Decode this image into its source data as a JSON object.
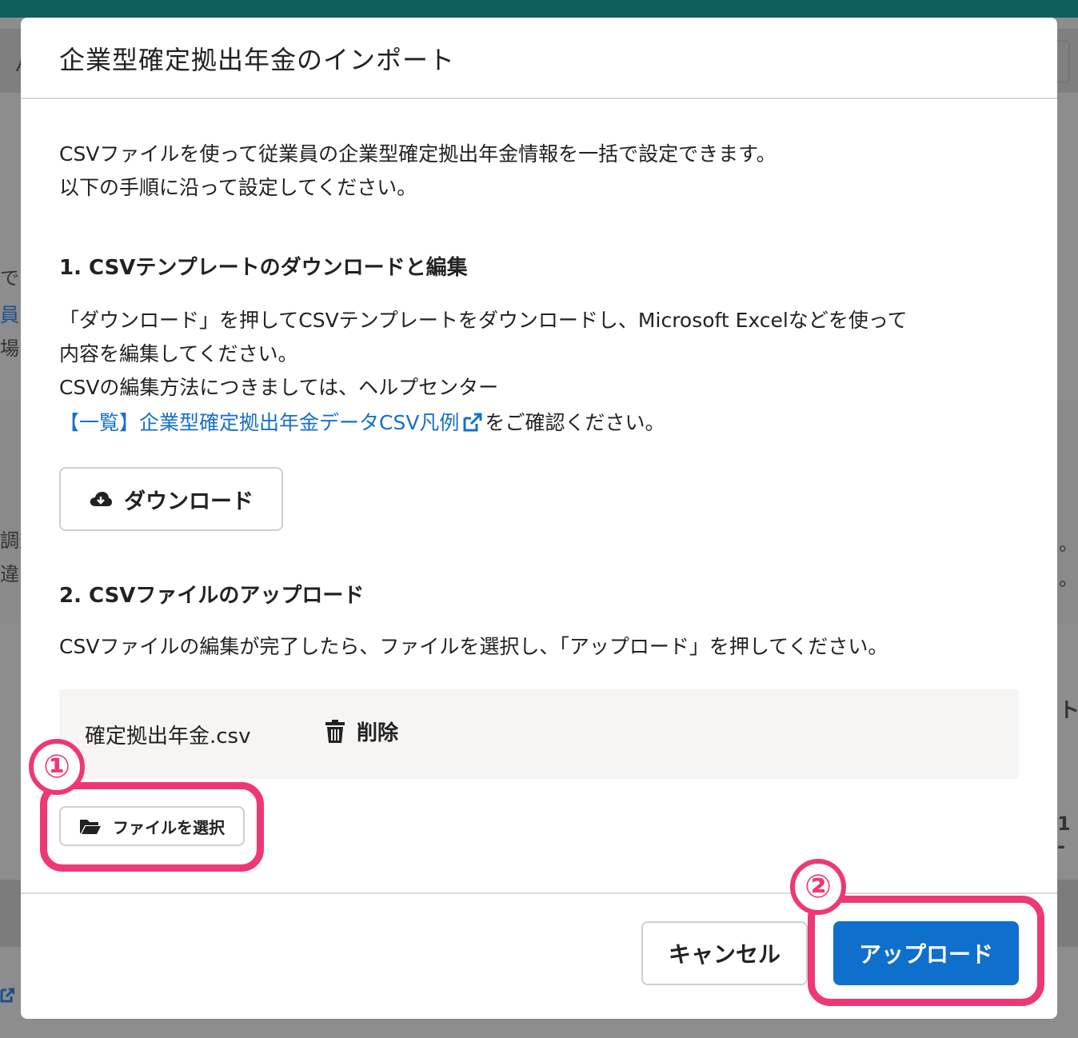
{
  "background": {
    "fragments": [
      "パ",
      "で",
      "員",
      "場",
      "調査",
      "違",
      "。",
      "。",
      "ト",
      "1 -"
    ]
  },
  "modal": {
    "title": "企業型確定拠出年金のインポート",
    "intro_line1": "CSVファイルを使って従業員の企業型確定拠出年金情報を一括で設定できます。",
    "intro_line2": "以下の手順に沿って設定してください。",
    "step1": {
      "heading": "1. CSVテンプレートのダウンロードと編集",
      "text_line1": "「ダウンロード」を押してCSVテンプレートをダウンロードし、Microsoft Excelなどを使って",
      "text_line2": "内容を編集してください。",
      "text_line3": "CSVの編集方法につきましては、ヘルプセンター",
      "help_link": "【一覧】企業型確定拠出年金データCSV凡例",
      "text_after_link": "をご確認ください。",
      "download_label": "ダウンロード"
    },
    "step2": {
      "heading": "2. CSVファイルのアップロード",
      "text": "CSVファイルの編集が完了したら、ファイルを選択し、「アップロード」を押してください。",
      "file_name": "確定拠出年金.csv",
      "delete_label": "削除",
      "select_label": "ファイルを選択"
    },
    "footer": {
      "cancel_label": "キャンセル",
      "upload_label": "アップロード"
    }
  },
  "annotations": {
    "callout1": "①",
    "callout2": "②",
    "color": "#ee3777"
  },
  "colors": {
    "accent": "#0f6fcd",
    "link": "#1570c7",
    "header_bar": "#0d5e5a"
  },
  "icons": [
    "cloud-download-icon",
    "external-link-icon",
    "trash-icon",
    "folder-open-icon"
  ]
}
